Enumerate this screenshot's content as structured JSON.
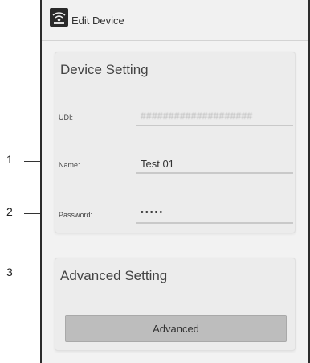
{
  "titlebar": {
    "title": "Edit Device",
    "icon": "wifi-device-icon"
  },
  "device_setting": {
    "section_title": "Device Setting",
    "fields": [
      {
        "label": "UDI:",
        "value": "####################"
      },
      {
        "label": "Name:",
        "value": "Test 01"
      },
      {
        "label": "Password:",
        "value": "•••••"
      }
    ]
  },
  "advanced_setting": {
    "section_title": "Advanced Setting",
    "button_label": "Advanced"
  },
  "callouts": [
    "1",
    "2",
    "3"
  ]
}
